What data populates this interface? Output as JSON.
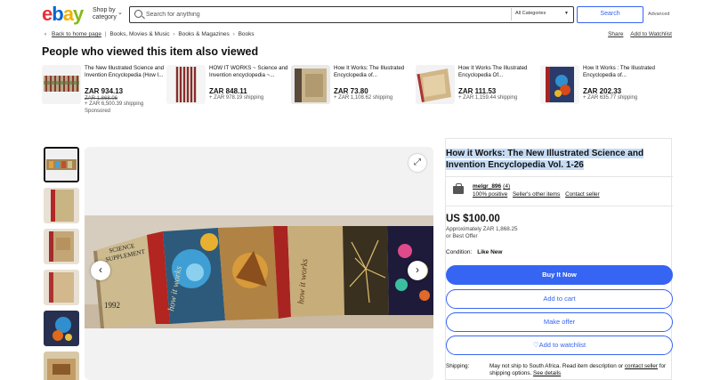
{
  "header": {
    "logo_letters": [
      "e",
      "b",
      "a",
      "y"
    ],
    "shop_by_line1": "Shop by",
    "shop_by_line2": "category",
    "search_placeholder": "Search for anything",
    "category": "All Categories",
    "search_button": "Search",
    "advanced": "Advanced"
  },
  "breadcrumb": {
    "back": "Back to home page",
    "items": [
      "Books, Movies & Music",
      "Books & Magazines",
      "Books"
    ],
    "share": "Share",
    "watchlist": "Add to Watchlist"
  },
  "related": {
    "title": "People who viewed this item also viewed",
    "items": [
      {
        "title": "The New Illustrated Science and Invention Encyclopedia (How I...",
        "price": "ZAR 934.13",
        "orig": "ZAR 1,868.06",
        "ship": "+ ZAR 6,500.39 shipping",
        "sponsored": "Sponsored"
      },
      {
        "title": "HOW IT WORKS ~ Science and Invention encyclopedia ~...",
        "price": "ZAR 848.11",
        "orig": "",
        "ship": "+ ZAR 978.19 shipping",
        "sponsored": ""
      },
      {
        "title": "How It Works: The Illustrated Encyclopedia of...",
        "price": "ZAR 73.80",
        "orig": "",
        "ship": "+ ZAR 1,108.62 shipping",
        "sponsored": ""
      },
      {
        "title": "How It Works The Illustrated Encyclopedia Of...",
        "price": "ZAR 111.53",
        "orig": "",
        "ship": "+ ZAR 1,159.44 shipping",
        "sponsored": ""
      },
      {
        "title": "How It Works : The Illustrated Encyclopedia of...",
        "price": "ZAR 202.33",
        "orig": "",
        "ship": "+ ZAR 635.77 shipping",
        "sponsored": ""
      }
    ]
  },
  "gallery": {
    "expand_icon": "expand-icon",
    "prev_icon": "chevron-left-icon",
    "next_icon": "chevron-right-icon",
    "photo_text": {
      "supplement_line1": "SCIENCE",
      "supplement_line2": "SUPPLEMENT",
      "year": "1992",
      "spine": "how it works"
    }
  },
  "listing": {
    "title": "How it Works: The New Illustrated Science and Invention Encyclopedia Vol. 1-26",
    "seller_name": "melgr_896",
    "seller_count": "(4)",
    "positive": "100% positive",
    "other_items": "Seller's other items",
    "contact": "Contact seller",
    "price": "US $100.00",
    "approx": "Approximately ZAR 1,868.25",
    "best_offer": "or Best Offer",
    "condition_label": "Condition:",
    "condition_value": "Like New",
    "buy_now": "Buy It Now",
    "add_to_cart": "Add to cart",
    "make_offer": "Make offer",
    "add_watchlist": "Add to watchlist",
    "shipping_label": "Shipping:",
    "shipping_text1": "May not ship to South Africa. Read item description or ",
    "shipping_contact": "contact seller",
    "shipping_text2": " for shipping options. ",
    "shipping_details": "See details"
  },
  "colors": {
    "accent": "#3665f3",
    "title_highlight": "#c6dcf5"
  }
}
